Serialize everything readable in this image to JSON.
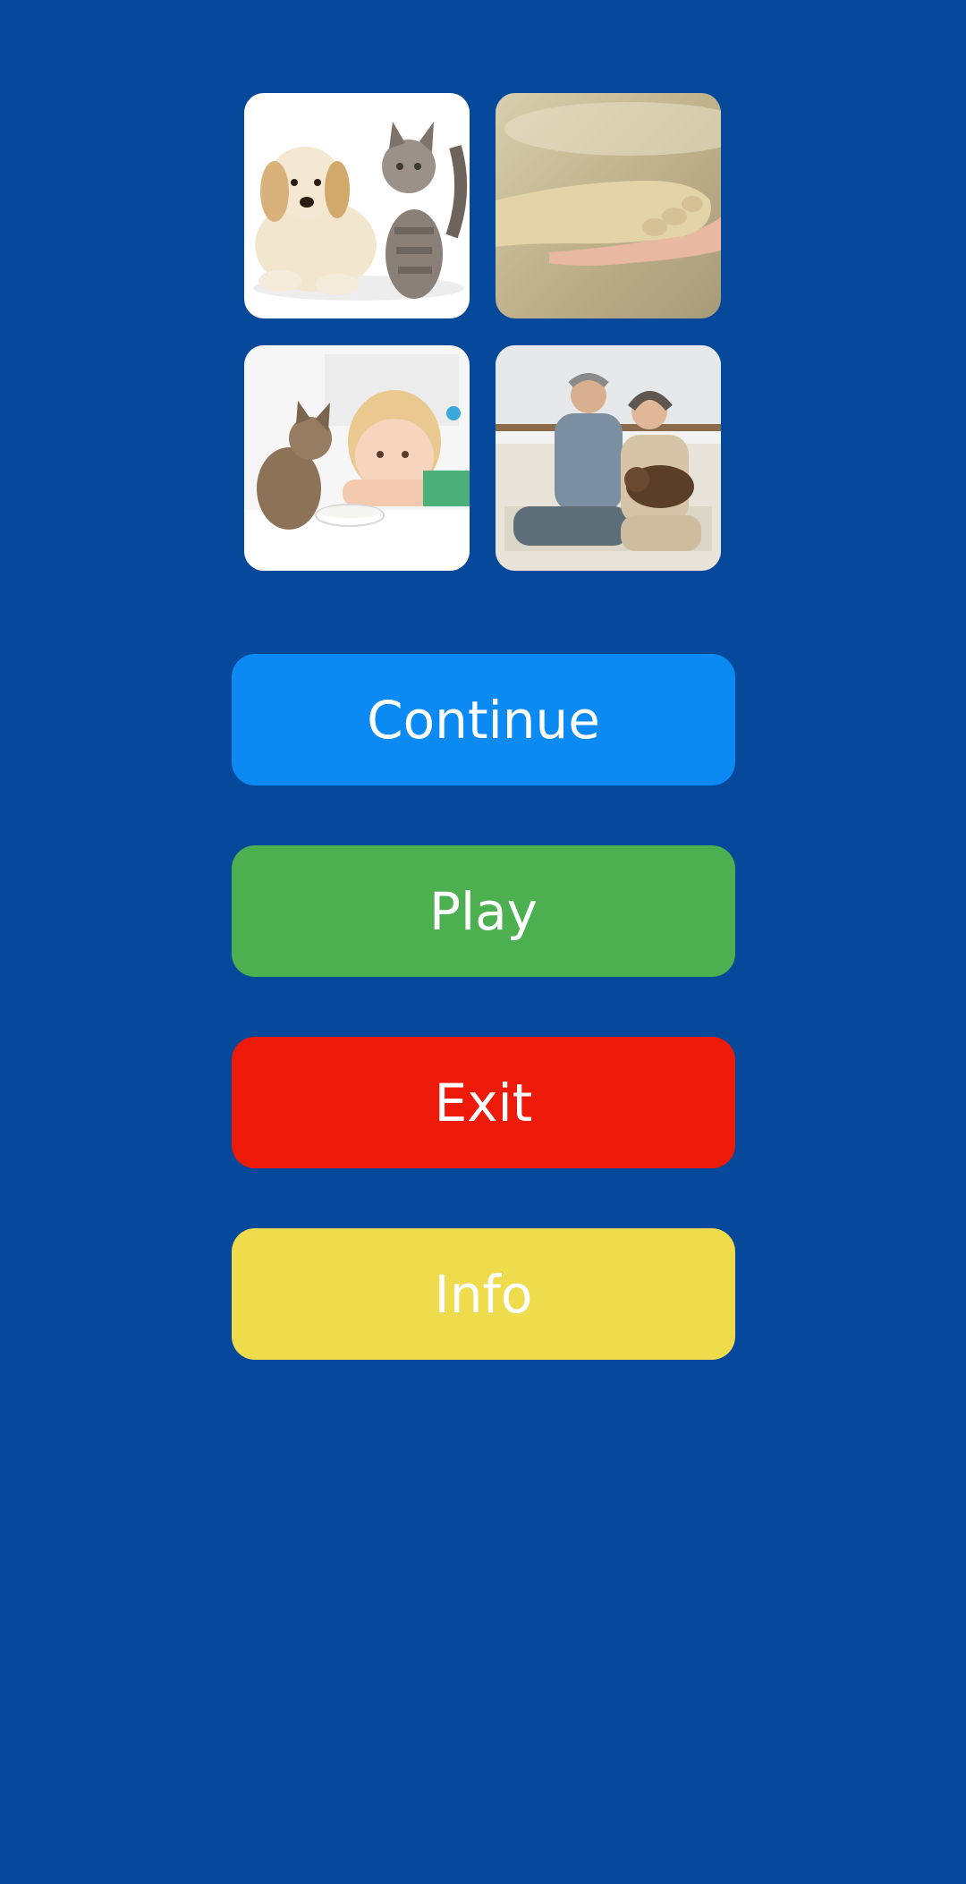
{
  "images": [
    {
      "name": "puppy-and-kitten-photo",
      "subject": "puppy and kitten"
    },
    {
      "name": "paw-in-hand-photo",
      "subject": "dog paw resting on a human hand"
    },
    {
      "name": "girl-with-kitten-photo",
      "subject": "girl and kitten with bowl of milk"
    },
    {
      "name": "elderly-couple-with-dog-photo",
      "subject": "elderly couple laughing with a dog on sofa"
    }
  ],
  "buttons": {
    "continue": {
      "label": "Continue",
      "color": "#0C8AF4"
    },
    "play": {
      "label": "Play",
      "color": "#4CB050"
    },
    "exit": {
      "label": "Exit",
      "color": "#ED1A0A"
    },
    "info": {
      "label": "Info",
      "color": "#EEDC4C"
    }
  },
  "colors": {
    "background": "#06499B",
    "button_text": "#FFFFFF"
  }
}
